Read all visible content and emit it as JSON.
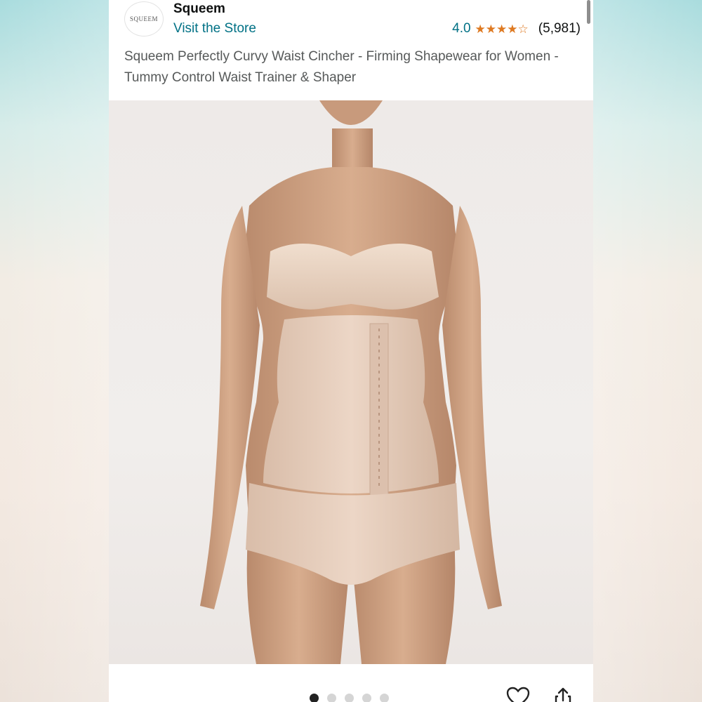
{
  "store": {
    "logo_text": "SQUEEM",
    "name": "Squeem",
    "visit_label": "Visit the Store"
  },
  "rating": {
    "value": "4.0",
    "stars_filled": 4,
    "stars_total": 5,
    "review_count": "(5,981)"
  },
  "product": {
    "title": "Squeem Perfectly Curvy Waist Cincher - Firming Shapewear for Women - Tummy Control Waist Trainer & Shaper"
  },
  "carousel": {
    "image_count": 5,
    "active_index": 0
  },
  "icons": {
    "heart": "heart-icon",
    "share": "share-icon"
  },
  "colors": {
    "link": "#007185",
    "star": "#de7921",
    "title_text": "#565959"
  }
}
